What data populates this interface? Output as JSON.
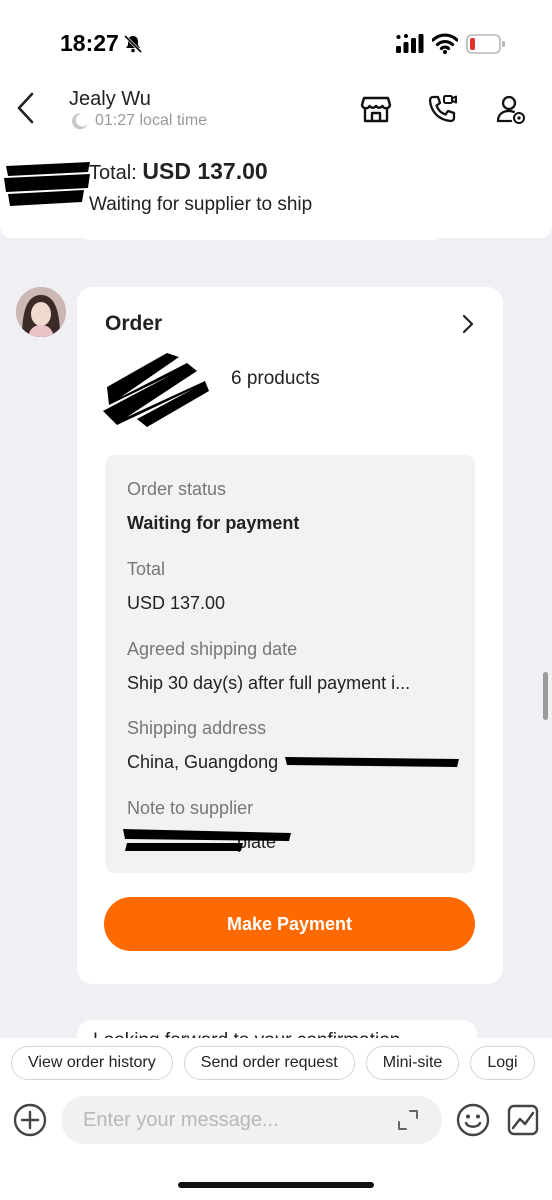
{
  "status_bar": {
    "time": "18:27",
    "icons": [
      "bell-off-icon",
      "cellular-signal-icon",
      "wifi-icon",
      "battery-low-icon"
    ],
    "battery_color": "#e5302b"
  },
  "header": {
    "back_icon": "chevron-left-icon",
    "contact_name": "Jealy Wu",
    "local_time": "01:27 local time",
    "icons": [
      "store-icon",
      "phone-video-icon",
      "profile-settings-icon"
    ]
  },
  "top_card": {
    "total_label": "Total:",
    "total_amount": "USD 137.00",
    "status": "Waiting for supplier to ship"
  },
  "order_card": {
    "title": "Order",
    "product_count": "6 products",
    "fields": [
      {
        "label": "Order status",
        "value": "Waiting for payment"
      },
      {
        "label": "Total",
        "value": "USD 137.00"
      },
      {
        "label": "Agreed shipping date",
        "value": "Ship 30 day(s) after full payment i..."
      },
      {
        "label": "Shipping address",
        "value": "China, Guangdong"
      },
      {
        "label": "Note to supplier",
        "value": "plate"
      }
    ],
    "pay_button": "Make Payment",
    "accent_color": "#ff6a00"
  },
  "next_message_preview": "Looking forward to your confirmation",
  "quick_actions": [
    "View order history",
    "Send order request",
    "Mini-site",
    "Logi"
  ],
  "composer": {
    "placeholder": "Enter your message...",
    "icons": [
      "plus-circle-icon",
      "expand-icon",
      "emoji-icon",
      "sticker-icon"
    ]
  }
}
